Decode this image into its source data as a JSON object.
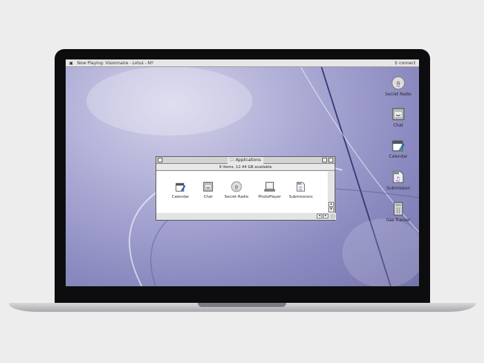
{
  "menubar": {
    "now_playing": "Now Playing: Visionnaire - Lotus - NY",
    "connect": "connect"
  },
  "desktop_icons": [
    {
      "label": "Secret Radio",
      "icon": "cd-music-icon"
    },
    {
      "label": "Chat",
      "icon": "chat-face-icon"
    },
    {
      "label": "Calendar",
      "icon": "calendar-icon"
    },
    {
      "label": "Submission",
      "icon": "music-document-icon"
    },
    {
      "label": "Gas Tracker",
      "icon": "calculator-icon"
    }
  ],
  "window": {
    "title": "Applications",
    "info": "9 items, 12.44 GB available",
    "items": [
      {
        "label": "Calendar",
        "icon": "calendar-icon"
      },
      {
        "label": "Chat",
        "icon": "chat-face-icon"
      },
      {
        "label": "Secret Radio",
        "icon": "cd-music-icon"
      },
      {
        "label": "PhotoPlayer",
        "icon": "photo-player-icon"
      },
      {
        "label": "Submissions",
        "icon": "music-document-icon"
      }
    ]
  }
}
